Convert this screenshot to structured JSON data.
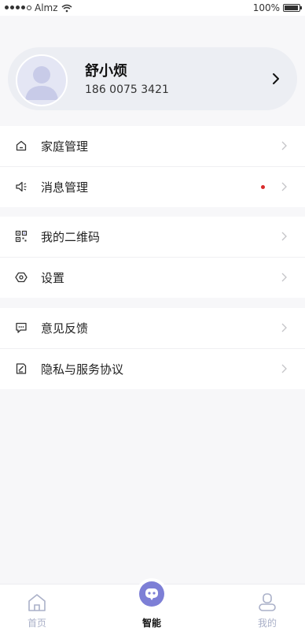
{
  "status_bar": {
    "carrier": "Almz",
    "battery": "100%"
  },
  "profile": {
    "name": "舒小烦",
    "phone": "186 0075 3421"
  },
  "menu": {
    "group1": [
      {
        "label": "家庭管理",
        "icon": "home-icon"
      },
      {
        "label": "消息管理",
        "icon": "speaker-icon",
        "unread": true
      }
    ],
    "group2": [
      {
        "label": "我的二维码",
        "icon": "qrcode-icon"
      },
      {
        "label": "设置",
        "icon": "settings-icon"
      }
    ],
    "group3": [
      {
        "label": "意见反馈",
        "icon": "feedback-icon"
      },
      {
        "label": "隐私与服务协议",
        "icon": "agreement-icon"
      }
    ]
  },
  "tab_bar": {
    "home": "首页",
    "smart": "智能",
    "mine": "我的"
  },
  "colors": {
    "accent": "#7d7fd6",
    "unread_dot": "#d92b2b",
    "inactive_tab": "#aab0c8"
  }
}
